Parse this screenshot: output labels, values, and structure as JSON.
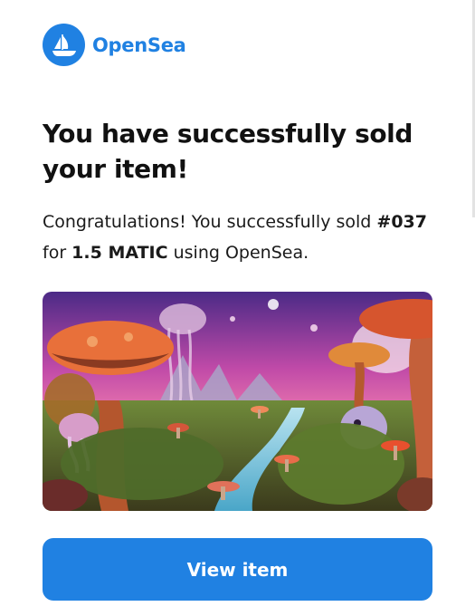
{
  "brand": {
    "name": "OpenSea",
    "icon": "opensea-ship-icon",
    "color": "#2081e2"
  },
  "email": {
    "title": "You have successfully sold your item!",
    "message": {
      "intro": "Congratulations! You successfully sold",
      "item": "#037",
      "connector": "for",
      "price": "1.5 MATIC",
      "outro": "using OpenSea."
    },
    "image_description": "psychedelic mushroom forest nft artwork",
    "cta_label": "View item"
  }
}
